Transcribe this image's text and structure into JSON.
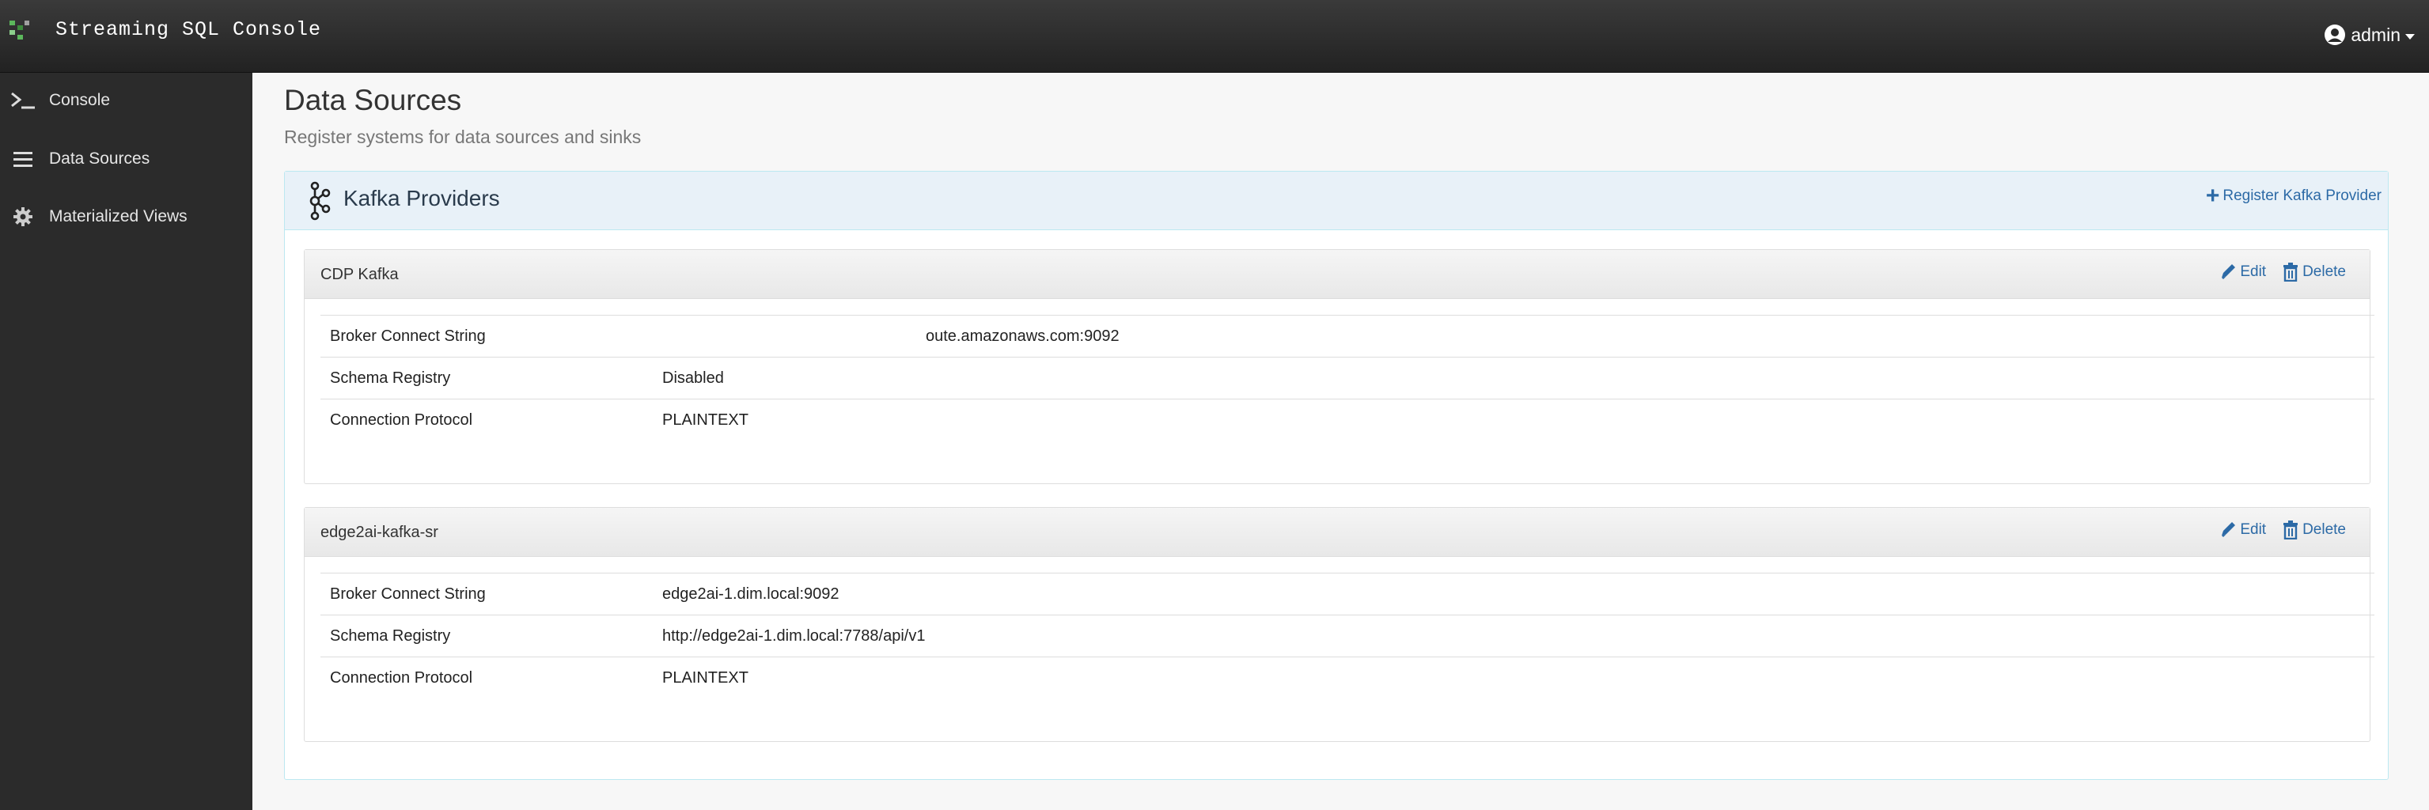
{
  "app": {
    "title": "Streaming SQL Console",
    "user": "admin"
  },
  "sidebar": {
    "items": [
      {
        "label": "Console",
        "icon": "terminal-icon"
      },
      {
        "label": "Data Sources",
        "icon": "list-icon"
      },
      {
        "label": "Materialized Views",
        "icon": "gear-icon"
      }
    ]
  },
  "page": {
    "title": "Data Sources",
    "subtitle": "Register systems for data sources and sinks"
  },
  "panel": {
    "heading": "Kafka Providers",
    "register_label": "Register Kafka Provider"
  },
  "providers": [
    {
      "name": "CDP Kafka",
      "edit_label": "Edit",
      "delete_label": "Delete",
      "rows": [
        {
          "key": "Broker Connect String",
          "value": "oute.amazonaws.com:9092"
        },
        {
          "key": "Schema Registry",
          "value": "Disabled"
        },
        {
          "key": "Connection Protocol",
          "value": "PLAINTEXT"
        }
      ]
    },
    {
      "name": "edge2ai-kafka-sr",
      "edit_label": "Edit",
      "delete_label": "Delete",
      "rows": [
        {
          "key": "Broker Connect String",
          "value": "edge2ai-1.dim.local:9092"
        },
        {
          "key": "Schema Registry",
          "value": "http://edge2ai-1.dim.local:7788/api/v1"
        },
        {
          "key": "Connection Protocol",
          "value": "PLAINTEXT"
        }
      ]
    }
  ],
  "colors": {
    "navbar": "#2a2a2a",
    "sidebar": "#2b2b2b",
    "link": "#2c6aa6",
    "panel_heading": "#e8f1f8",
    "logo_green": "#5cb85c"
  }
}
